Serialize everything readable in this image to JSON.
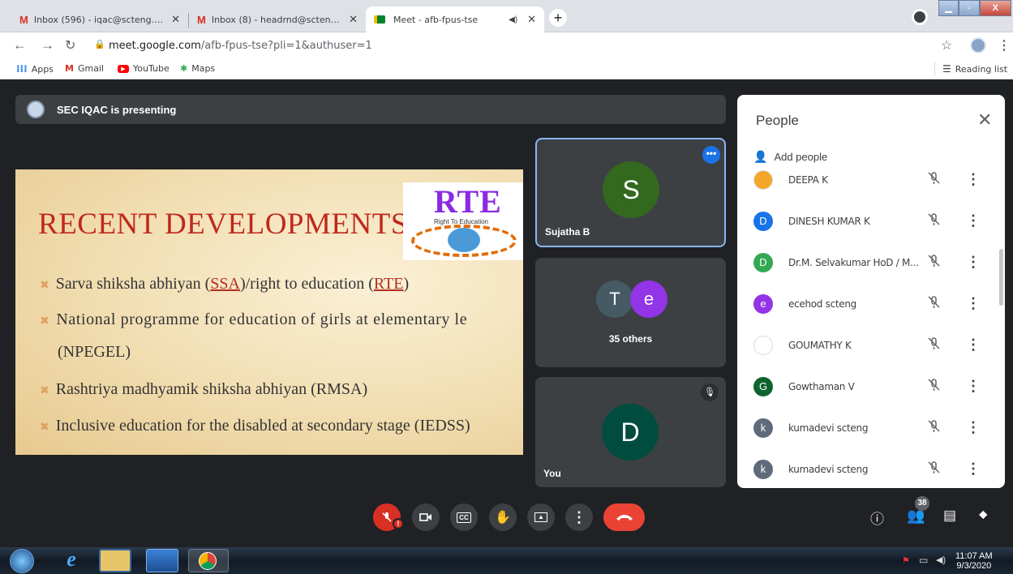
{
  "browser": {
    "tabs": [
      {
        "title": "Inbox (596) - iqac@scteng.co.in -"
      },
      {
        "title": "Inbox (8) - headrnd@scteng.co.in"
      },
      {
        "title": "Meet - afb-fpus-tse"
      }
    ],
    "url_host": "meet.google.com",
    "url_path": "/afb-fpus-tse?pli=1&authuser=1",
    "bookmarks": [
      "Apps",
      "Gmail",
      "YouTube",
      "Maps"
    ],
    "reading_list": "Reading list"
  },
  "meet": {
    "presenting_banner": "SEC IQAC is presenting",
    "slide": {
      "title": "RECENT DEVELOPMENTS",
      "logo_text": "RTE",
      "logo_subtext": "Right To Education",
      "b1_pre": "Sarva shiksha abhiyan (",
      "b1_ssa": "SSA",
      "b1_mid": ")/right to education (",
      "b1_rte": "RTE",
      "b1_post": ")",
      "b2_line1": "National programme for education of girls at elementary le",
      "b2_line2": "(NPEGEL)",
      "b3": "Rashtriya madhyamik shiksha abhiyan (RMSA)",
      "b4": "Inclusive education for the disabled at secondary stage (IEDSS)"
    },
    "tiles": [
      {
        "name": "Sujatha B",
        "initial": "S"
      },
      {
        "name": "35 others",
        "initial1": "T",
        "initial2": "e"
      },
      {
        "name": "You",
        "initial": "D"
      }
    ],
    "people_panel": {
      "title": "People",
      "add_people": "Add people",
      "participants": [
        {
          "name": "DEEPA K",
          "initial": "",
          "color": "#f4a62a"
        },
        {
          "name": "DINESH KUMAR K",
          "initial": "D",
          "color": "#1a73e8"
        },
        {
          "name": "Dr.M. Selvakumar HoD / M...",
          "initial": "D",
          "color": "#34a853"
        },
        {
          "name": "ecehod scteng",
          "initial": "e",
          "color": "#9334e6"
        },
        {
          "name": "GOUMATHY K",
          "initial": "",
          "color": "#ffffff"
        },
        {
          "name": "Gowthaman V",
          "initial": "G",
          "color": "#0d652d"
        },
        {
          "name": "kumadevi scteng",
          "initial": "k",
          "color": "#5f6b7a"
        },
        {
          "name": "kumadevi scteng",
          "initial": "k",
          "color": "#5f6b7a"
        }
      ]
    },
    "participant_count": "38"
  },
  "taskbar": {
    "time": "11:07 AM",
    "date": "9/3/2020"
  }
}
